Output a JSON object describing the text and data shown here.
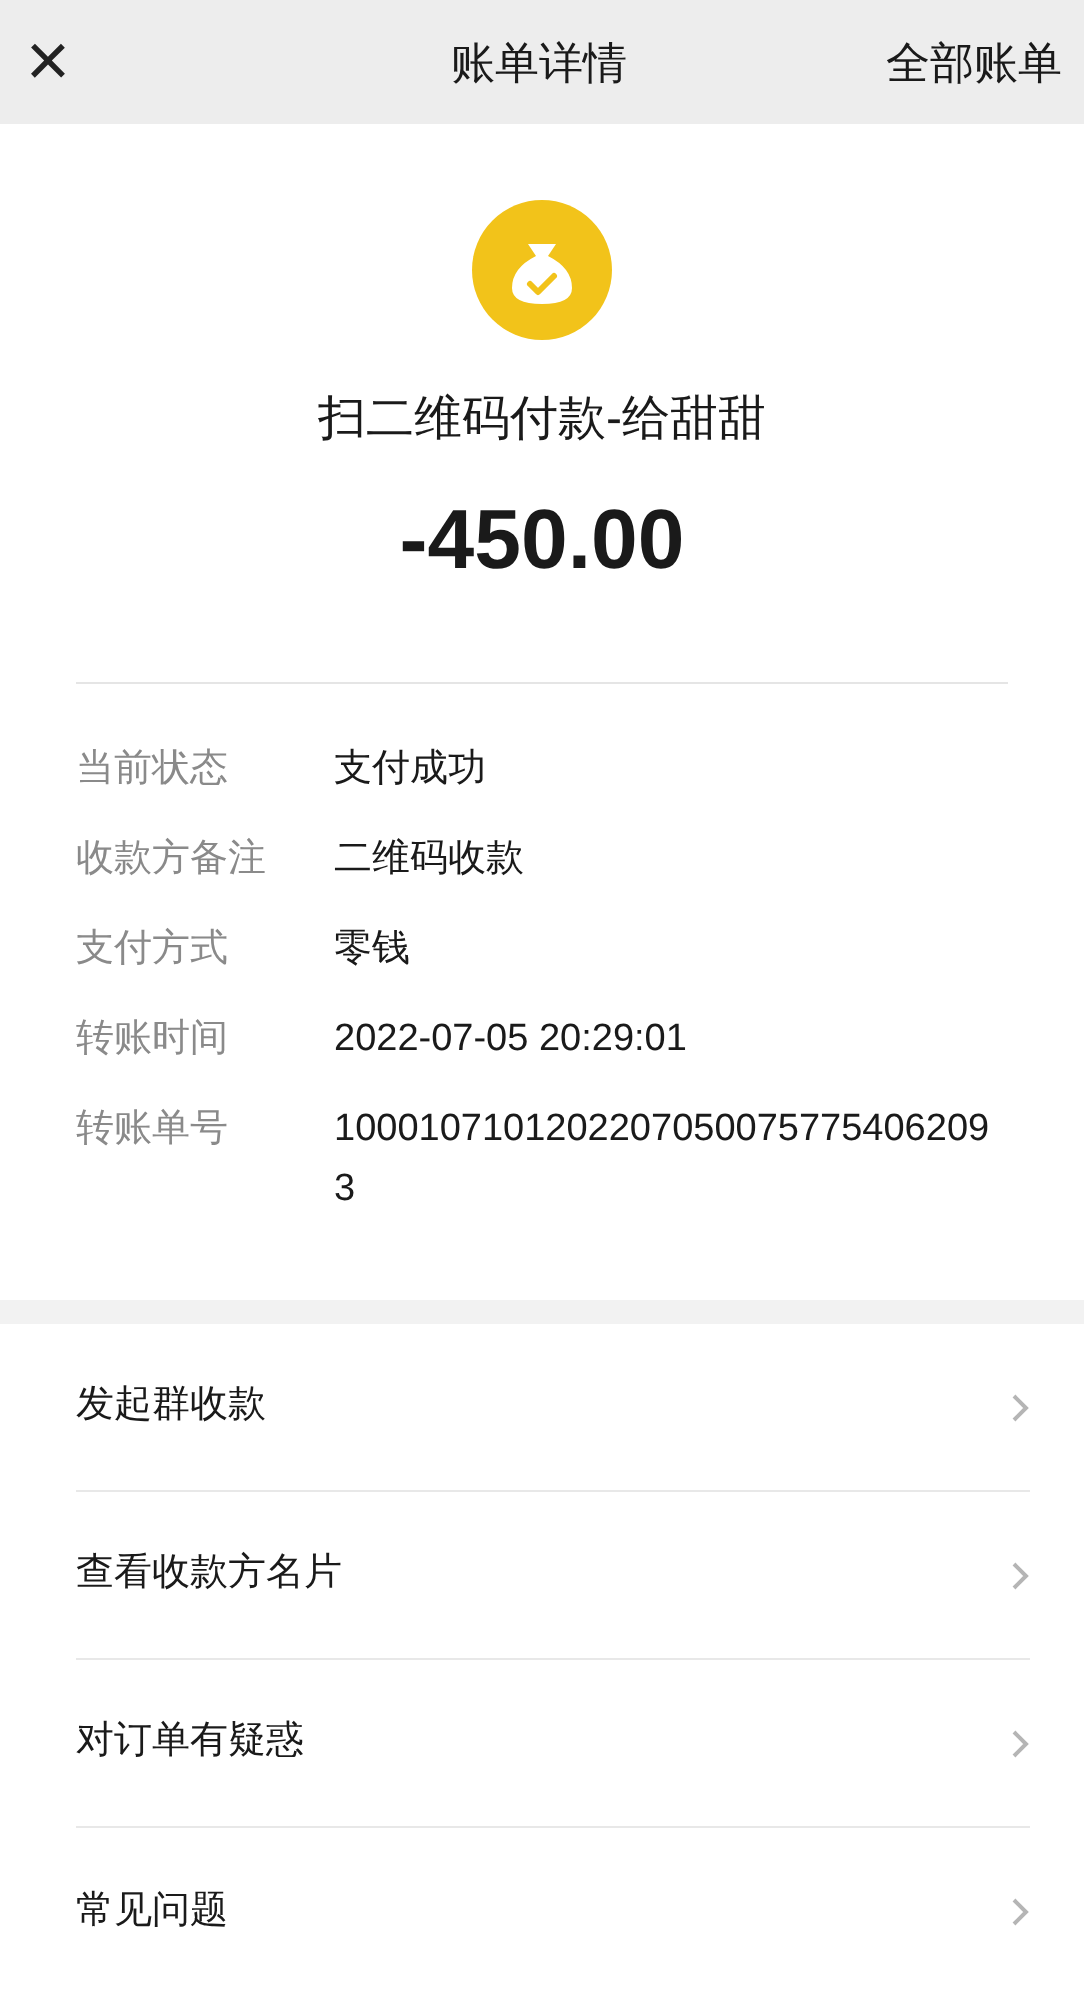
{
  "header": {
    "close": "×",
    "title": "账单详情",
    "action": "全部账单"
  },
  "summary": {
    "title": "扫二维码付款-给甜甜",
    "amount": "-450.00"
  },
  "details": [
    {
      "label": "当前状态",
      "value": "支付成功"
    },
    {
      "label": "收款方备注",
      "value": "二维码收款"
    },
    {
      "label": "支付方式",
      "value": "零钱"
    },
    {
      "label": "转账时间",
      "value": "2022-07-05 20:29:01"
    },
    {
      "label": "转账单号",
      "value": "10001071012022070500757754062093"
    }
  ],
  "menu": [
    {
      "label": "发起群收款"
    },
    {
      "label": "查看收款方名片"
    },
    {
      "label": "对订单有疑惑"
    },
    {
      "label": "常见问题"
    }
  ]
}
